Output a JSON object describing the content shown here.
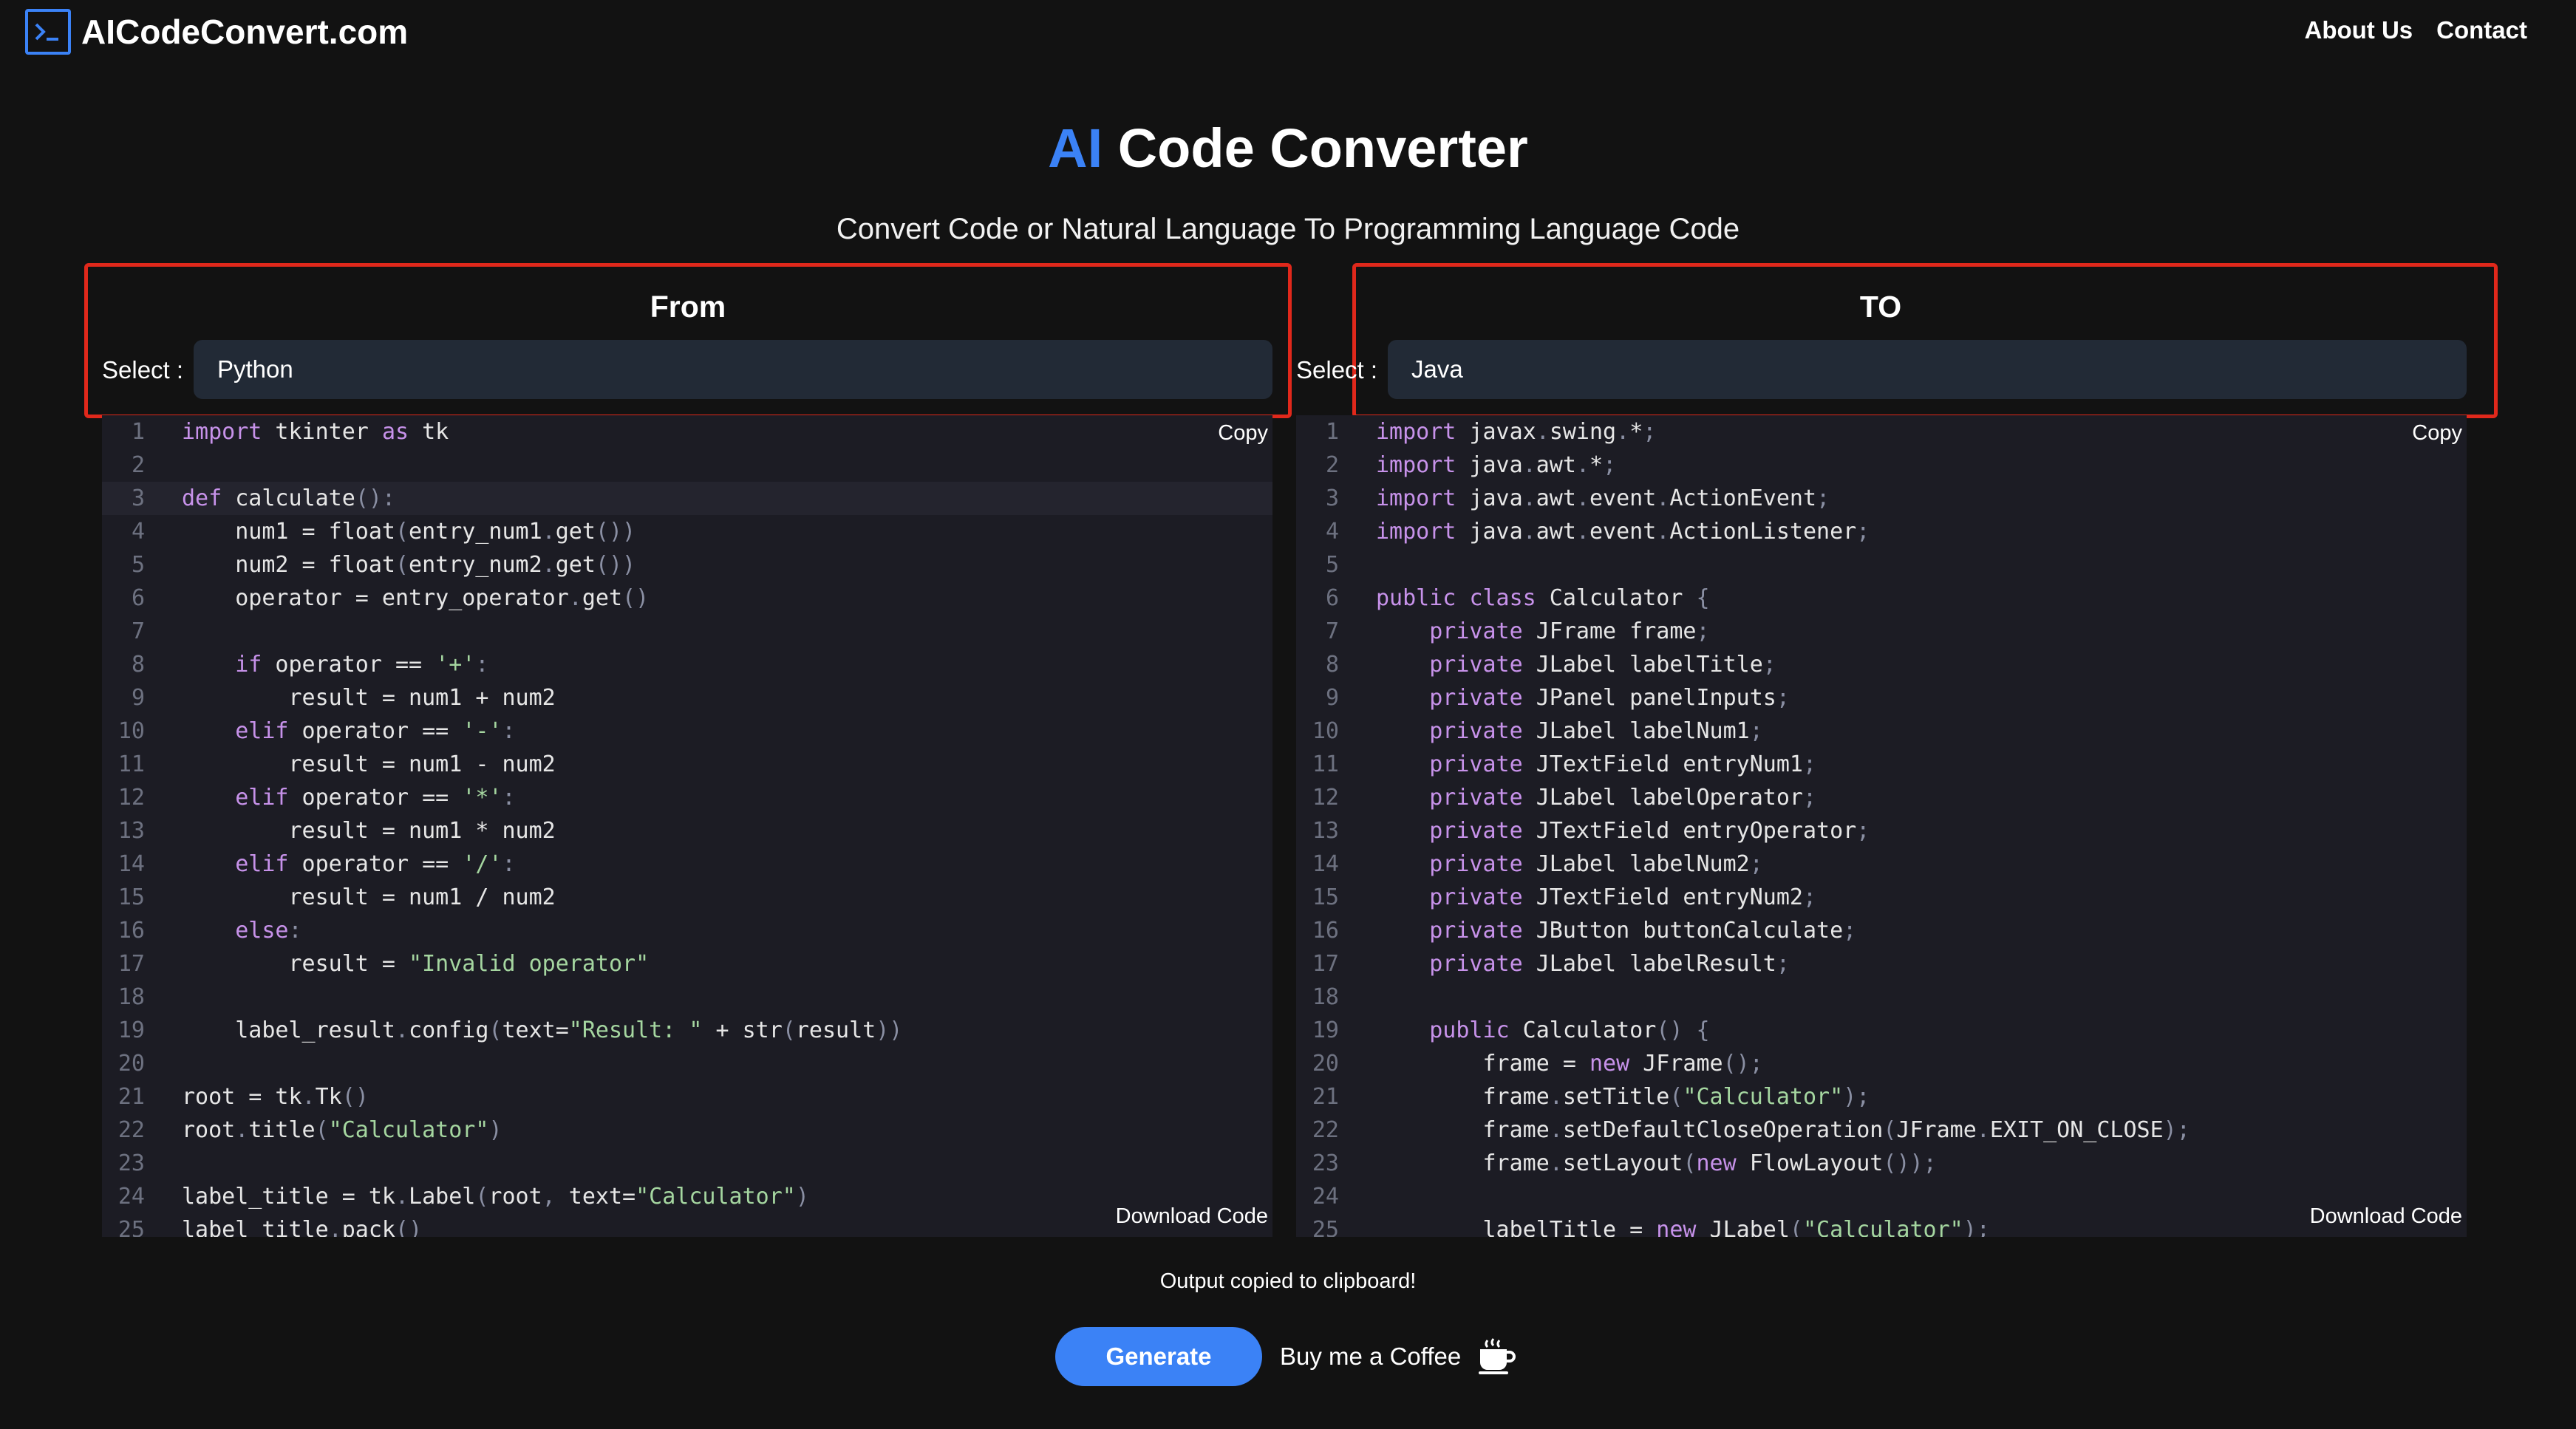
{
  "nav": {
    "brand": "AICodeConvert.com",
    "links": [
      "About Us",
      "Contact"
    ]
  },
  "hero": {
    "title_accent": "AI",
    "title_rest": "Code Converter",
    "subtitle": "Convert Code or Natural Language To Programming Language Code"
  },
  "from_panel": {
    "heading": "From",
    "select_label": "Select :",
    "selected_language": "Python",
    "copy_label": "Copy",
    "download_label": "Download Code",
    "lines": [
      "import tkinter as tk",
      "",
      "def calculate():",
      "    num1 = float(entry_num1.get())",
      "    num2 = float(entry_num2.get())",
      "    operator = entry_operator.get()",
      "",
      "    if operator == '+':",
      "        result = num1 + num2",
      "    elif operator == '-':",
      "        result = num1 - num2",
      "    elif operator == '*':",
      "        result = num1 * num2",
      "    elif operator == '/':",
      "        result = num1 / num2",
      "    else:",
      "        result = \"Invalid operator\"",
      "",
      "    label_result.config(text=\"Result: \" + str(result))",
      "",
      "root = tk.Tk()",
      "root.title(\"Calculator\")",
      "",
      "label_title = tk.Label(root, text=\"Calculator\")",
      "label title.pack()"
    ]
  },
  "to_panel": {
    "heading": "TO",
    "select_label": "Select :",
    "selected_language": "Java",
    "copy_label": "Copy",
    "download_label": "Download Code",
    "lines": [
      "import javax.swing.*;",
      "import java.awt.*;",
      "import java.awt.event.ActionEvent;",
      "import java.awt.event.ActionListener;",
      "",
      "public class Calculator {",
      "    private JFrame frame;",
      "    private JLabel labelTitle;",
      "    private JPanel panelInputs;",
      "    private JLabel labelNum1;",
      "    private JTextField entryNum1;",
      "    private JLabel labelOperator;",
      "    private JTextField entryOperator;",
      "    private JLabel labelNum2;",
      "    private JTextField entryNum2;",
      "    private JButton buttonCalculate;",
      "    private JLabel labelResult;",
      "",
      "    public Calculator() {",
      "        frame = new JFrame();",
      "        frame.setTitle(\"Calculator\");",
      "        frame.setDefaultCloseOperation(JFrame.EXIT_ON_CLOSE);",
      "        frame.setLayout(new FlowLayout());",
      "",
      "        labelTitle = new JLabel(\"Calculator\");"
    ]
  },
  "status_message": "Output copied to clipboard!",
  "actions": {
    "generate_label": "Generate",
    "coffee_label": "Buy me a Coffee"
  },
  "colors": {
    "accent": "#3b82f6",
    "highlight": "#e0281b",
    "background": "#121212",
    "editor_bg": "#1c1c24"
  }
}
